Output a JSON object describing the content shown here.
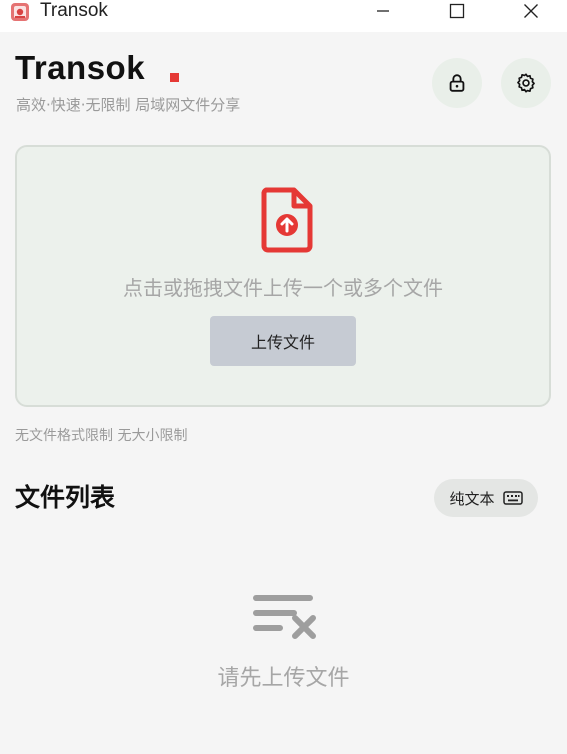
{
  "window": {
    "title": "Transok",
    "controls": {
      "minimize_icon": "minimize-icon",
      "maximize_icon": "maximize-icon",
      "close_icon": "close-icon"
    }
  },
  "header": {
    "brand": "Transok",
    "tagline": "高效·快速·无限制 局域网文件分享",
    "lock_icon": "lock-icon",
    "settings_icon": "gear-icon"
  },
  "dropzone": {
    "icon": "file-upload-icon",
    "hint": "点击或拖拽文件上传一个或多个文件",
    "button_label": "上传文件"
  },
  "limit_note": "无文件格式限制 无大小限制",
  "file_list": {
    "title": "文件列表",
    "plaintext_label": "纯文本",
    "keyboard_icon": "keyboard-icon",
    "empty_icon": "clear-list-icon",
    "empty_text": "请先上传文件"
  },
  "colors": {
    "accent": "#e53935",
    "background": "#f5f5f5",
    "dropzone_bg": "#ecf1ec",
    "button_bg": "#c6cbd3",
    "muted_text": "#a6a6a6"
  }
}
